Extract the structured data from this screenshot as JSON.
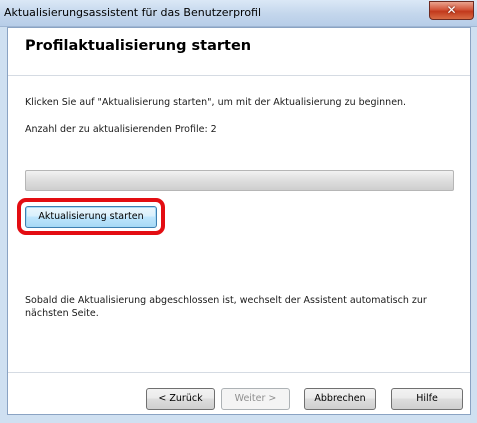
{
  "window": {
    "title": "Aktualisierungsassistent für das Benutzerprofil",
    "close_symbol": "✕"
  },
  "page": {
    "header": "Profilaktualisierung starten",
    "instruction": "Klicken Sie auf \"Aktualisierung starten\", um mit der Aktualisierung zu beginnen.",
    "profile_count_label": "Anzahl der zu aktualisierenden Profile: 2",
    "progress": 0,
    "start_button_label": "Aktualisierung starten",
    "completion_note_line1": "Sobald die Aktualisierung abgeschlossen ist, wechselt der Assistent automatisch zur",
    "completion_note_line2": "nächsten Seite."
  },
  "footer": {
    "back_label": "< Zurück",
    "next_label": "Weiter >",
    "cancel_label": "Abbrechen",
    "help_label": "Hilfe"
  },
  "colors": {
    "highlight": "#e30d12",
    "titlebar": "#c3d6ec"
  }
}
